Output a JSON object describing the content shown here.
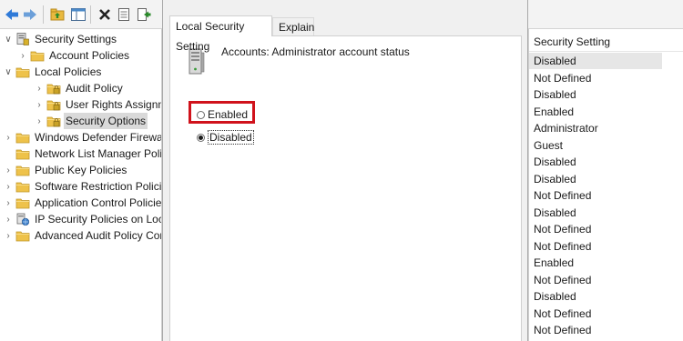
{
  "toolbar": {
    "icons": [
      "back-arrow-icon",
      "forward-arrow-icon",
      "up-folder-icon",
      "show-hide-tree-icon",
      "delete-icon",
      "properties-icon",
      "export-list-icon"
    ]
  },
  "tree": {
    "items": [
      {
        "label": "Security Settings",
        "expander": "chevron-down",
        "icon": "security-settings-icon"
      },
      {
        "label": "Account Policies",
        "expander": "chevron-right",
        "icon": "folder-icon"
      },
      {
        "label": "Local Policies",
        "expander": "chevron-down",
        "icon": "folder-icon"
      },
      {
        "label": "Audit Policy",
        "expander": "chevron-right",
        "icon": "folder-icon"
      },
      {
        "label": "User Rights Assignment",
        "expander": "chevron-right",
        "icon": "folder-icon"
      },
      {
        "label": "Security Options",
        "expander": "chevron-right",
        "icon": "folder-icon",
        "selected": true
      },
      {
        "label": "Windows Defender Firewall",
        "expander": "chevron-right",
        "icon": "folder-icon"
      },
      {
        "label": "Network List Manager Polic",
        "expander": "",
        "icon": "folder-icon"
      },
      {
        "label": "Public Key Policies",
        "expander": "chevron-right",
        "icon": "folder-icon"
      },
      {
        "label": "Software Restriction Policie",
        "expander": "chevron-right",
        "icon": "folder-icon"
      },
      {
        "label": "Application Control Policies",
        "expander": "chevron-right",
        "icon": "folder-icon"
      },
      {
        "label": "IP Security Policies on Local",
        "expander": "chevron-right",
        "icon": "ip-security-icon"
      },
      {
        "label": "Advanced Audit Policy Con",
        "expander": "chevron-right",
        "icon": "folder-icon"
      }
    ]
  },
  "dialog": {
    "tabs": [
      {
        "label": "Local Security Setting",
        "active": true
      },
      {
        "label": "Explain",
        "active": false
      }
    ],
    "policy_title": "Accounts: Administrator account status",
    "options": [
      {
        "label": "Enabled",
        "checked": false,
        "highlighted": true
      },
      {
        "label": "Disabled",
        "checked": true,
        "focused": true
      }
    ],
    "highlight_color": "#d0121b"
  },
  "security_setting_column": {
    "header": "Security Setting",
    "values": [
      "Disabled",
      "Not Defined",
      "Disabled",
      "Enabled",
      "Administrator",
      "Guest",
      "Disabled",
      "Disabled",
      "Not Defined",
      "Disabled",
      "Not Defined",
      "Not Defined",
      "Enabled",
      "Not Defined",
      "Disabled",
      "Not Defined",
      "Not Defined"
    ]
  }
}
